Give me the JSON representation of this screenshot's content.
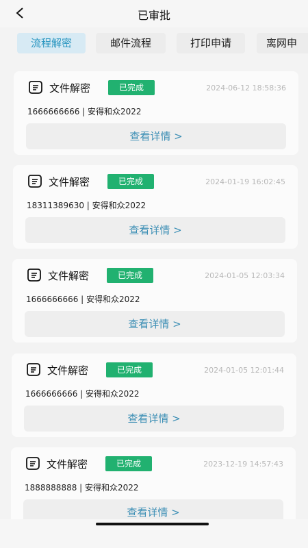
{
  "header": {
    "title": "已审批"
  },
  "tabs": [
    {
      "label": "流程解密",
      "active": true
    },
    {
      "label": "邮件流程",
      "active": false
    },
    {
      "label": "打印申请",
      "active": false
    },
    {
      "label": "离网申",
      "active": false
    }
  ],
  "cards": [
    {
      "title": "文件解密",
      "status": "已完成",
      "time": "2024-06-12 18:58:36",
      "info": "1666666666 | 安得和众2022",
      "action": "查看详情 >"
    },
    {
      "title": "文件解密",
      "status": "已完成",
      "time": "2024-01-19 16:02:45",
      "info": "18311389630 | 安得和众2022",
      "action": "查看详情 >"
    },
    {
      "title": "文件解密",
      "status": "已完成",
      "time": "2024-01-05 12:03:34",
      "info": "1666666666 | 安得和众2022",
      "action": "查看详情 >"
    },
    {
      "title": "文件解密",
      "status": "已完成",
      "time": "2024-01-05 12:01:44",
      "info": "1666666666 | 安得和众2022",
      "action": "查看详情 >"
    },
    {
      "title": "文件解密",
      "status": "已完成",
      "time": "2023-12-19 14:57:43",
      "info": "1888888888 | 安得和众2022",
      "action": "查看详情 >"
    }
  ],
  "colors": {
    "accent": "#2a96c0",
    "status_done": "#21b170",
    "link": "#3d8fb5"
  },
  "icons": {
    "back": "chevron-left-icon",
    "card": "document-icon"
  }
}
